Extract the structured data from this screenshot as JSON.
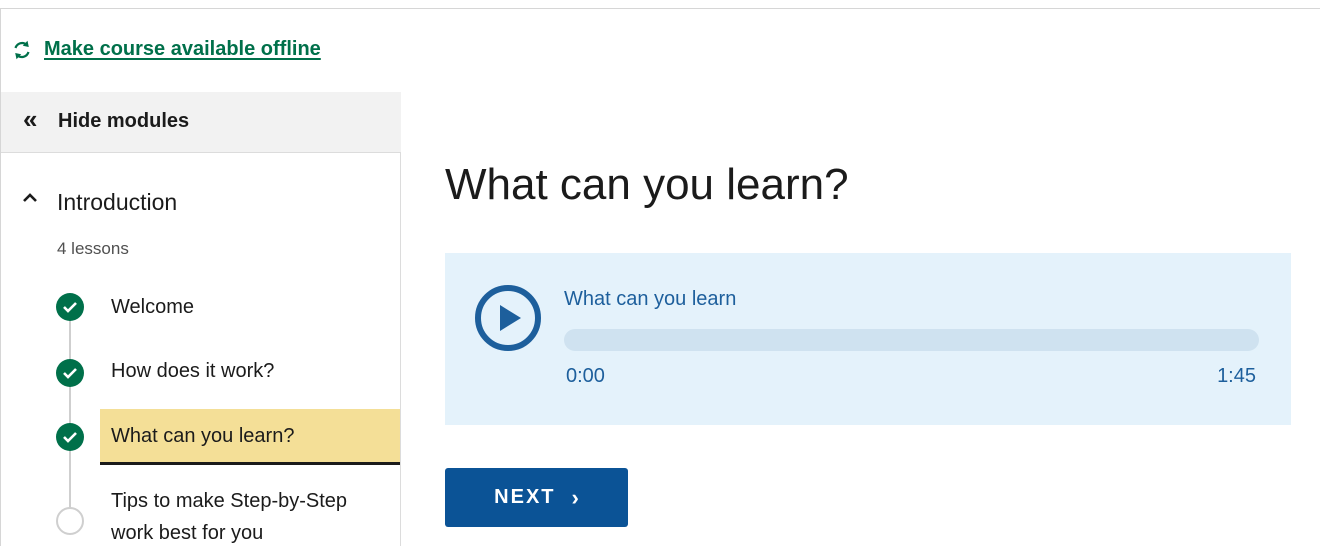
{
  "offline_link": {
    "label": "Make course available offline",
    "icon": "sync-icon"
  },
  "sidebar": {
    "toggle": {
      "label": "Hide modules",
      "icon": "double-chevron-left-icon"
    },
    "module": {
      "title": "Introduction",
      "lesson_count": "4 lessons",
      "lessons": [
        {
          "label": "Welcome",
          "status": "complete"
        },
        {
          "label": "How does it work?",
          "status": "complete"
        },
        {
          "label": "What can you learn?",
          "status": "complete",
          "current": true
        },
        {
          "label": "Tips to make Step-by-Step work best for you",
          "status": "incomplete"
        }
      ]
    }
  },
  "main": {
    "title": "What can you learn?",
    "audio": {
      "title": "What can you learn",
      "current_time": "0:00",
      "duration": "1:45",
      "progress_fraction": 0
    },
    "next_button": {
      "label": "NEXT",
      "icon": "chevron-right-icon"
    }
  },
  "colors": {
    "accent_green": "#00704a",
    "highlight": "#f4df97",
    "player_bg": "#e4f2fb",
    "player_blue": "#1d5f9c",
    "button_blue": "#0b5396"
  }
}
